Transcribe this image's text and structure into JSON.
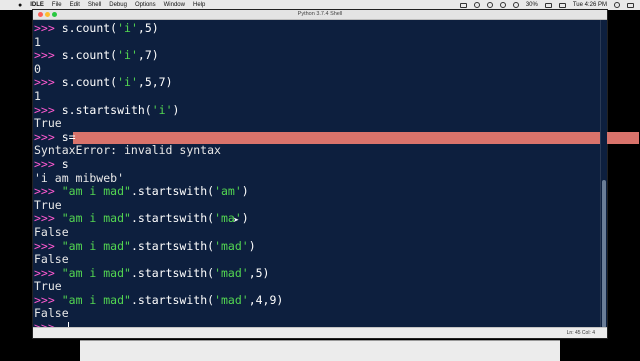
{
  "menubar": {
    "app": "IDLE",
    "items": [
      "File",
      "Edit",
      "Shell",
      "Debug",
      "Options",
      "Window",
      "Help"
    ],
    "battery": "30%",
    "clock": "Tue 4:26 PM"
  },
  "window": {
    "title": "Python 3.7.4 Shell"
  },
  "status": {
    "position": "Ln: 45   Col: 4"
  },
  "prompt": ">>>",
  "lines": [
    {
      "type": "cmd",
      "pre": "s.count(",
      "str": "'i'",
      "post": ",5)"
    },
    {
      "type": "out",
      "text": "1"
    },
    {
      "type": "cmd",
      "pre": "s.count(",
      "str": "'i'",
      "post": ",7)"
    },
    {
      "type": "out",
      "text": "0"
    },
    {
      "type": "cmd",
      "pre": "s.count(",
      "str": "'i'",
      "post": ",5,7)"
    },
    {
      "type": "out",
      "text": "1"
    },
    {
      "type": "cmd",
      "pre": "s.startswith(",
      "str": "'i'",
      "post": ")"
    },
    {
      "type": "out",
      "text": "True"
    },
    {
      "type": "cmd",
      "pre": "s=",
      "str": "",
      "post": "",
      "highlight": true
    },
    {
      "type": "out",
      "text": "SyntaxError: invalid syntax"
    },
    {
      "type": "cmd",
      "pre": "s",
      "str": "",
      "post": ""
    },
    {
      "type": "out",
      "text": "'i am mibweb'"
    },
    {
      "type": "cmd",
      "pre": "",
      "str": "\"am i mad\"",
      "post": ".startswith(",
      "str2": "'am'",
      "post2": ")"
    },
    {
      "type": "out",
      "text": "True"
    },
    {
      "type": "cmd",
      "pre": "",
      "str": "\"am i mad\"",
      "post": ".startswith(",
      "str2": "'ma'",
      "post2": ")"
    },
    {
      "type": "out",
      "text": "False"
    },
    {
      "type": "cmd",
      "pre": "",
      "str": "\"am i mad\"",
      "post": ".startswith(",
      "str2": "'mad'",
      "post2": ")"
    },
    {
      "type": "out",
      "text": "False"
    },
    {
      "type": "cmd",
      "pre": "",
      "str": "\"am i mad\"",
      "post": ".startswith(",
      "str2": "'mad'",
      "post2": ",5)"
    },
    {
      "type": "out",
      "text": "True"
    },
    {
      "type": "cmd",
      "pre": "",
      "str": "\"am i mad\"",
      "post": ".startswith(",
      "str2": "'mad'",
      "post2": ",4,9)"
    },
    {
      "type": "out",
      "text": "False"
    },
    {
      "type": "input"
    }
  ]
}
